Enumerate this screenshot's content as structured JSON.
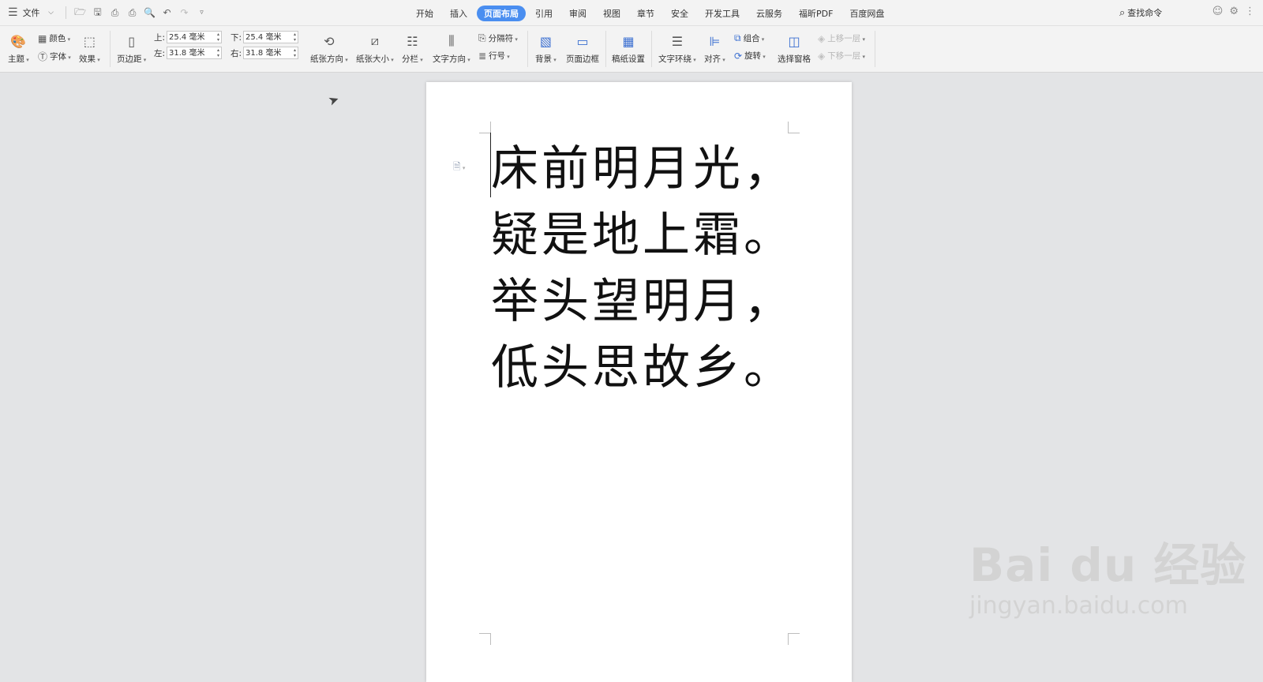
{
  "topbar": {
    "file_label": "文件",
    "tabs": [
      "开始",
      "插入",
      "页面布局",
      "引用",
      "审阅",
      "视图",
      "章节",
      "安全",
      "开发工具",
      "云服务",
      "福昕PDF",
      "百度网盘"
    ],
    "active_tab": "页面布局",
    "search_label": "查找命令"
  },
  "ribbon": {
    "theme": "主题",
    "color": "颜色",
    "font": "字体",
    "effect": "效果",
    "margins": "页边距",
    "margin_top_label": "上:",
    "margin_top_value": "25.4 毫米",
    "margin_bottom_label": "下:",
    "margin_bottom_value": "25.4 毫米",
    "margin_left_label": "左:",
    "margin_left_value": "31.8 毫米",
    "margin_right_label": "右:",
    "margin_right_value": "31.8 毫米",
    "orientation": "纸张方向",
    "size": "纸张大小",
    "columns": "分栏",
    "text_direction": "文字方向",
    "breaks": "分隔符",
    "line_numbers": "行号",
    "background": "背景",
    "page_border": "页面边框",
    "manuscript": "稿纸设置",
    "wrap": "文字环绕",
    "align": "对齐",
    "group": "组合",
    "rotate": "旋转",
    "selection_pane": "选择窗格",
    "bring_forward": "上移一层",
    "send_backward": "下移一层"
  },
  "document": {
    "lines": [
      "床前明月光，",
      "疑是地上霜。",
      "举头望明月，",
      "低头思故乡。"
    ]
  },
  "watermark": {
    "brand": "Bai du 经验",
    "url": "jingyan.baidu.com"
  }
}
